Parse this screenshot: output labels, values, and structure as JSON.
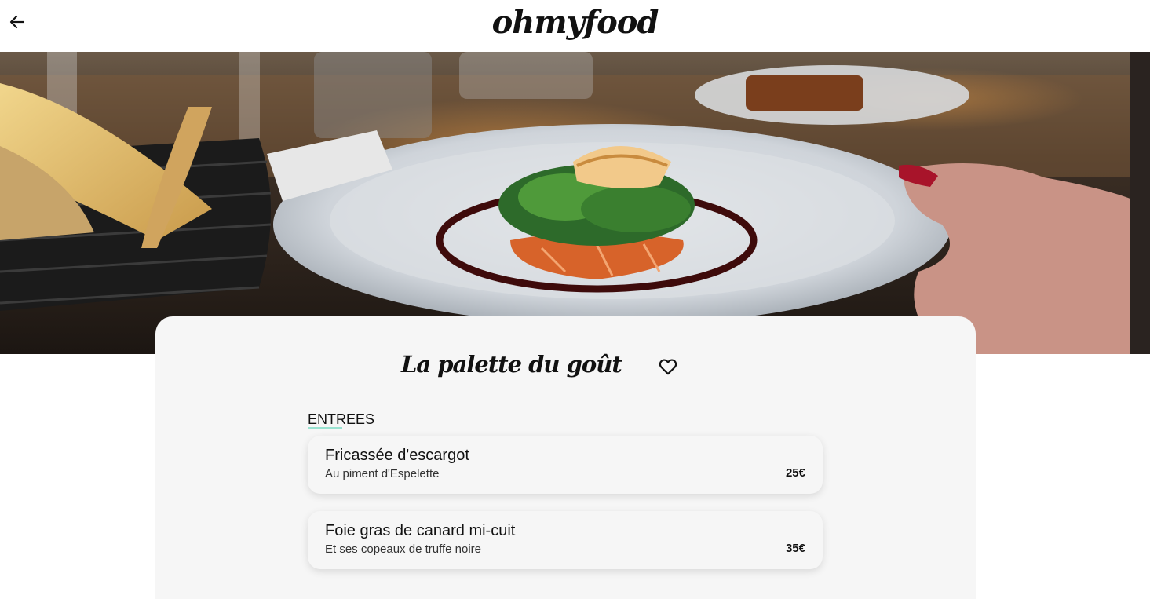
{
  "header": {
    "back_icon": "arrow-left-icon",
    "logo": "ohmyfood"
  },
  "hero": {
    "description_icon": "plated-dish-photo"
  },
  "restaurant": {
    "name": "La palette du goût",
    "favorite_icon": "heart-outline-icon"
  },
  "menu": {
    "section_title": "ENTREES",
    "accent_color": "#99e2d0",
    "dishes": [
      {
        "name": "Fricassée d'escargot",
        "description": "Au piment d'Espelette",
        "price": "25€"
      },
      {
        "name": "Foie gras de canard mi-cuit",
        "description": "Et ses copeaux de truffe noire",
        "price": "35€"
      }
    ]
  }
}
